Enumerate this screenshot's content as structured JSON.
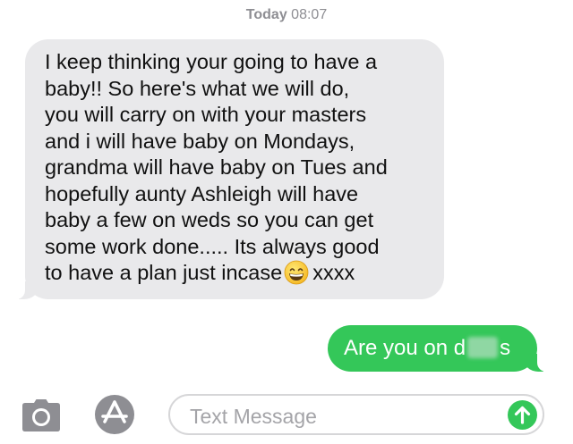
{
  "header": {
    "timestamp_day": "Today",
    "timestamp_time": "08:07"
  },
  "conversation": {
    "incoming_message": {
      "lines": [
        "I keep thinking your going to have a",
        "baby!! So here's what we will do,",
        "you will carry on with your masters",
        "and i will have baby on Mondays,",
        "grandma will have baby on Tues and",
        "hopefully aunty Ashleigh will have",
        "baby a few on weds so you can get",
        "some work done..... Its always good",
        "to have a plan just incase"
      ],
      "emoji": "grinning-face-with-smiling-eyes",
      "signoff": "xxxx",
      "bubble_color": "#e9e9eb"
    },
    "outgoing_message": {
      "text_before": "Are you on d",
      "text_after": "s",
      "redacted": true,
      "bubble_color": "#34c759"
    }
  },
  "composer": {
    "placeholder": "Text Message",
    "camera_icon": "camera-icon",
    "appstore_icon": "app-store-icon",
    "send_icon": "arrow-up-icon",
    "accent": "#34c759"
  }
}
